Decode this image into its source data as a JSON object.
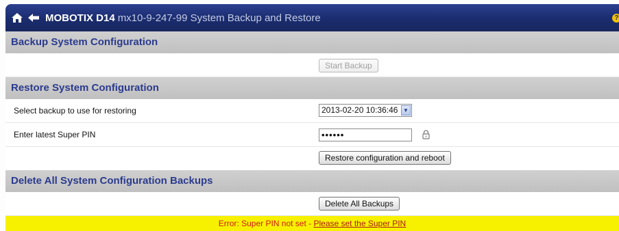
{
  "header": {
    "brand": "MOBOTIX D14",
    "subtitle": "mx10-9-247-99 System Backup and Restore",
    "home_icon": "home-icon",
    "back_icon": "back-arrow-icon",
    "help_icon": "help-icon",
    "help_glyph": "?"
  },
  "backup": {
    "title": "Backup System Configuration",
    "start_button": "Start Backup"
  },
  "restore": {
    "title": "Restore System Configuration",
    "select_label": "Select backup to use for restoring",
    "select_value": "2013-02-20 10:36:46",
    "pin_label": "Enter latest Super PIN",
    "pin_value": "••••••",
    "lock_icon": "lock-icon",
    "restore_button": "Restore configuration and reboot"
  },
  "delete": {
    "title": "Delete All System Configuration Backups",
    "delete_button": "Delete All Backups"
  },
  "error": {
    "message": "Error: Super PIN not set - ",
    "link": "Please set the Super PIN"
  },
  "colors": {
    "title_bar": "#1b2c6e",
    "section_header": "#c8c8c8",
    "section_text": "#2b3b8e",
    "error_bar": "#f7f100",
    "error_text": "#d01818"
  }
}
